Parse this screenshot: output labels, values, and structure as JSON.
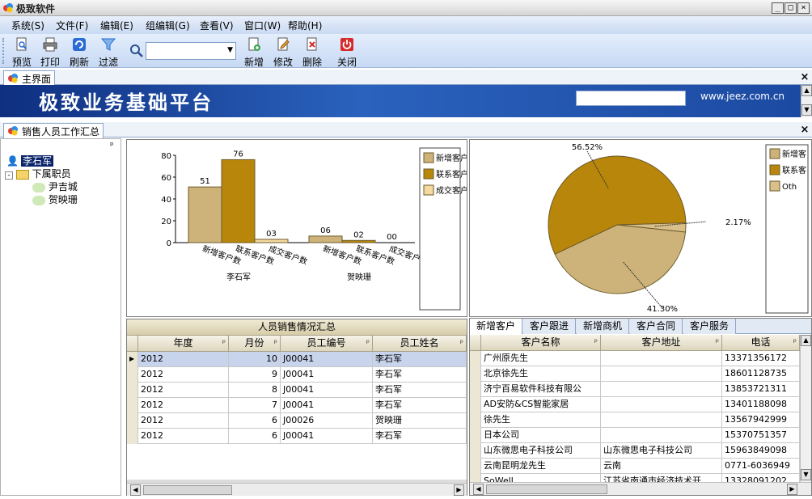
{
  "window": {
    "title": "极致软件",
    "min": "_",
    "max": "□",
    "close": "×"
  },
  "menu": [
    "系统(S)",
    "文件(F)",
    "编辑(E)",
    "组编辑(G)",
    "查看(V)",
    "窗口(W)",
    "帮助(H)"
  ],
  "toolbar": {
    "preview": "预览",
    "print": "打印",
    "refresh": "刷新",
    "filter": "过滤",
    "search_value": "",
    "add": "新增",
    "edit": "修改",
    "delete": "删除",
    "close": "关闭"
  },
  "tabs": {
    "main": "主界面",
    "summary": "销售人员工作汇总",
    "close": "×"
  },
  "banner": {
    "title": "极致业务基础平台",
    "url": "www.jeez.com.cn",
    "search_value": ""
  },
  "tree": {
    "pin": "ᵖ",
    "root": "李石军",
    "group": "下属职员",
    "children": [
      "尹吉城",
      "贺映珊"
    ]
  },
  "chart_data": [
    {
      "type": "bar",
      "categories": [
        "李石军",
        "贺映珊"
      ],
      "tick_labels": [
        "新增客户数",
        "联系客户数",
        "成交客户数"
      ],
      "series": [
        {
          "name": "新增客户数",
          "values": [
            51,
            6
          ],
          "labels": [
            "51",
            "06"
          ]
        },
        {
          "name": "联系客户数",
          "values": [
            76,
            2
          ],
          "labels": [
            "76",
            "02"
          ]
        },
        {
          "name": "成交客户数",
          "values": [
            3,
            0
          ],
          "labels": [
            "03",
            "00"
          ]
        }
      ],
      "yticks": [
        "0",
        "20",
        "40",
        "60",
        "80"
      ],
      "ylim": [
        0,
        80
      ],
      "legend": [
        "新增客户数",
        "联系客户数",
        "成交客户数"
      ],
      "legend_position": "right",
      "colors": [
        "#cdb37a",
        "#b8860b",
        "#f4d9a0"
      ]
    },
    {
      "type": "pie",
      "labels": [
        "新增客户数",
        "联系客户数",
        "Others"
      ],
      "values": [
        41.3,
        56.52,
        2.17
      ],
      "value_labels": [
        "41.30%",
        "56.52%",
        "2.17%"
      ],
      "legend": [
        "新增客户数",
        "联系客户数",
        "Others"
      ],
      "legend_position": "right",
      "colors": [
        "#cdb37a",
        "#b8860b",
        "#d9c08a"
      ]
    }
  ],
  "sales_table": {
    "title": "人员销售情况汇总",
    "columns": [
      "年度",
      "月份",
      "员工编号",
      "员工姓名"
    ],
    "rows": [
      [
        "2012",
        "10",
        "J00041",
        "李石军"
      ],
      [
        "2012",
        "9",
        "J00041",
        "李石军"
      ],
      [
        "2012",
        "8",
        "J00041",
        "李石军"
      ],
      [
        "2012",
        "7",
        "J00041",
        "李石军"
      ],
      [
        "2012",
        "6",
        "J00026",
        "贺映珊"
      ],
      [
        "2012",
        "6",
        "J00041",
        "李石军"
      ]
    ]
  },
  "customer_tabs": [
    "新增客户",
    "客户跟进",
    "新增商机",
    "客户合同",
    "客户服务"
  ],
  "customer_table": {
    "columns": [
      "客户名称",
      "客户地址",
      "电话"
    ],
    "rows": [
      [
        "广州原先生",
        "",
        "13371356172"
      ],
      [
        "北京徐先生",
        "",
        "18601128735"
      ],
      [
        "济宁百易软件科技有限公",
        "",
        "13853721311"
      ],
      [
        "AD安防&CS智能家居",
        "",
        "13401188098"
      ],
      [
        "徐先生",
        "",
        "13567942999"
      ],
      [
        "日本公司",
        "",
        "15370751357"
      ],
      [
        "山东微思电子科技公司",
        "山东微思电子科技公司",
        "15963849098"
      ],
      [
        "云南昆明龙先生",
        "云南",
        "0771-6036949"
      ],
      [
        "SoWell",
        "江苏省南通市经济技术开",
        "13328091202"
      ]
    ]
  }
}
